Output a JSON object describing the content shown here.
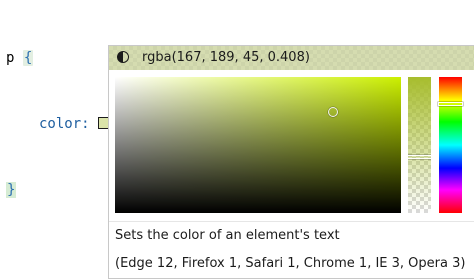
{
  "editor": {
    "selector": "p",
    "open_brace": "{",
    "property": "color:",
    "value": "rgba(167, 189, 45, 0.408)",
    "semicolon": ";",
    "close_brace": "}"
  },
  "color_picker": {
    "header_text": "rgba(167, 189, 45, 0.408)",
    "header_icon": "contrast-icon",
    "color": {
      "r": 167,
      "g": 189,
      "b": 45,
      "a": 0.408
    },
    "hue_base_color": "#ccf000",
    "description": "Sets the color of an element's text",
    "compatibility": "(Edge 12, Firefox 1, Safari 1, Chrome 1, IE 3, Opera 3)"
  },
  "colors": {
    "accent_blue": "#1f5fa0",
    "brace_highlight": "#d6ecd4"
  }
}
